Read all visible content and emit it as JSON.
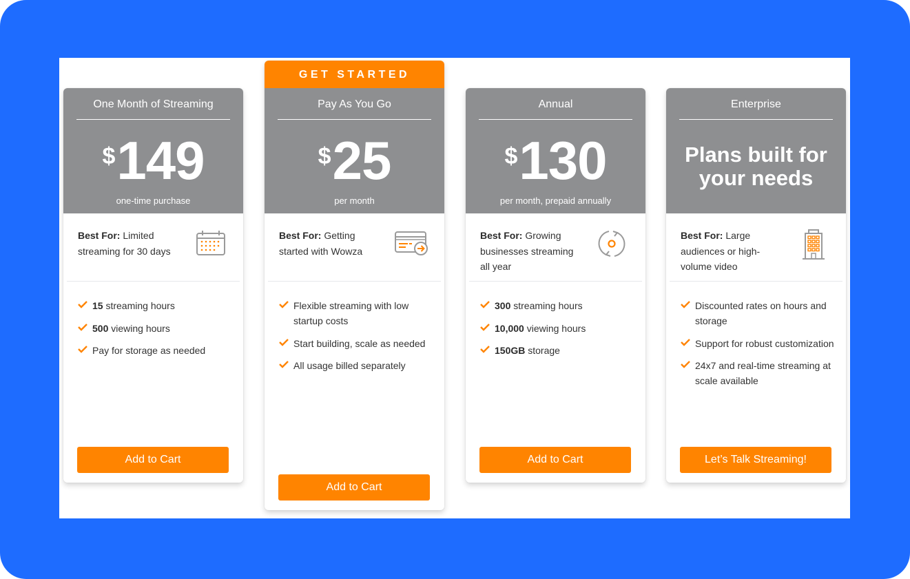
{
  "colors": {
    "frame": "#1e6cff",
    "header_gray": "#8e8f91",
    "accent_orange": "#ff8400",
    "text_dark": "#333333"
  },
  "plans": [
    {
      "name": "One Month of Streaming",
      "ribbon": null,
      "price_currency": "$",
      "price_amount": "149",
      "price_note": "one-time purchase",
      "best_for_label": "Best For:",
      "best_for_text": "Limited streaming for 30 days",
      "icon": "calendar-icon",
      "features": [
        {
          "bold": "15",
          "text": " streaming hours"
        },
        {
          "bold": "500",
          "text": " viewing hours"
        },
        {
          "bold": "",
          "text": "Pay for storage as needed"
        }
      ],
      "cta_label": "Add to Cart"
    },
    {
      "name": "Pay As You Go",
      "ribbon": "GET STARTED",
      "price_currency": "$",
      "price_amount": "25",
      "price_note": "per month",
      "best_for_label": "Best For:",
      "best_for_text": "Getting started with Wowza",
      "icon": "billing-card-arrow-icon",
      "features": [
        {
          "bold": "",
          "text": "Flexible streaming with low startup costs"
        },
        {
          "bold": "",
          "text": "Start building, scale as needed"
        },
        {
          "bold": "",
          "text": "All usage billed separately"
        }
      ],
      "cta_label": "Add to Cart"
    },
    {
      "name": "Annual",
      "ribbon": null,
      "price_currency": "$",
      "price_amount": "130",
      "price_note": "per month, prepaid annually",
      "best_for_label": "Best For:",
      "best_for_text": "Growing businesses streaming all year",
      "icon": "renew-cycle-icon",
      "features": [
        {
          "bold": "300",
          "text": " streaming hours"
        },
        {
          "bold": "10,000",
          "text": " viewing hours"
        },
        {
          "bold": "150GB",
          "text": " storage"
        }
      ],
      "cta_label": "Add to Cart"
    },
    {
      "name": "Enterprise",
      "ribbon": null,
      "tagline": "Plans built for your needs",
      "best_for_label": "Best For:",
      "best_for_text": "Large audiences or high-volume video",
      "icon": "office-building-icon",
      "features": [
        {
          "bold": "",
          "text": "Discounted rates on hours and storage"
        },
        {
          "bold": "",
          "text": "Support for robust customization"
        },
        {
          "bold": "",
          "text": "24x7 and real-time streaming at scale available"
        }
      ],
      "cta_label": "Let’s Talk Streaming!"
    }
  ]
}
